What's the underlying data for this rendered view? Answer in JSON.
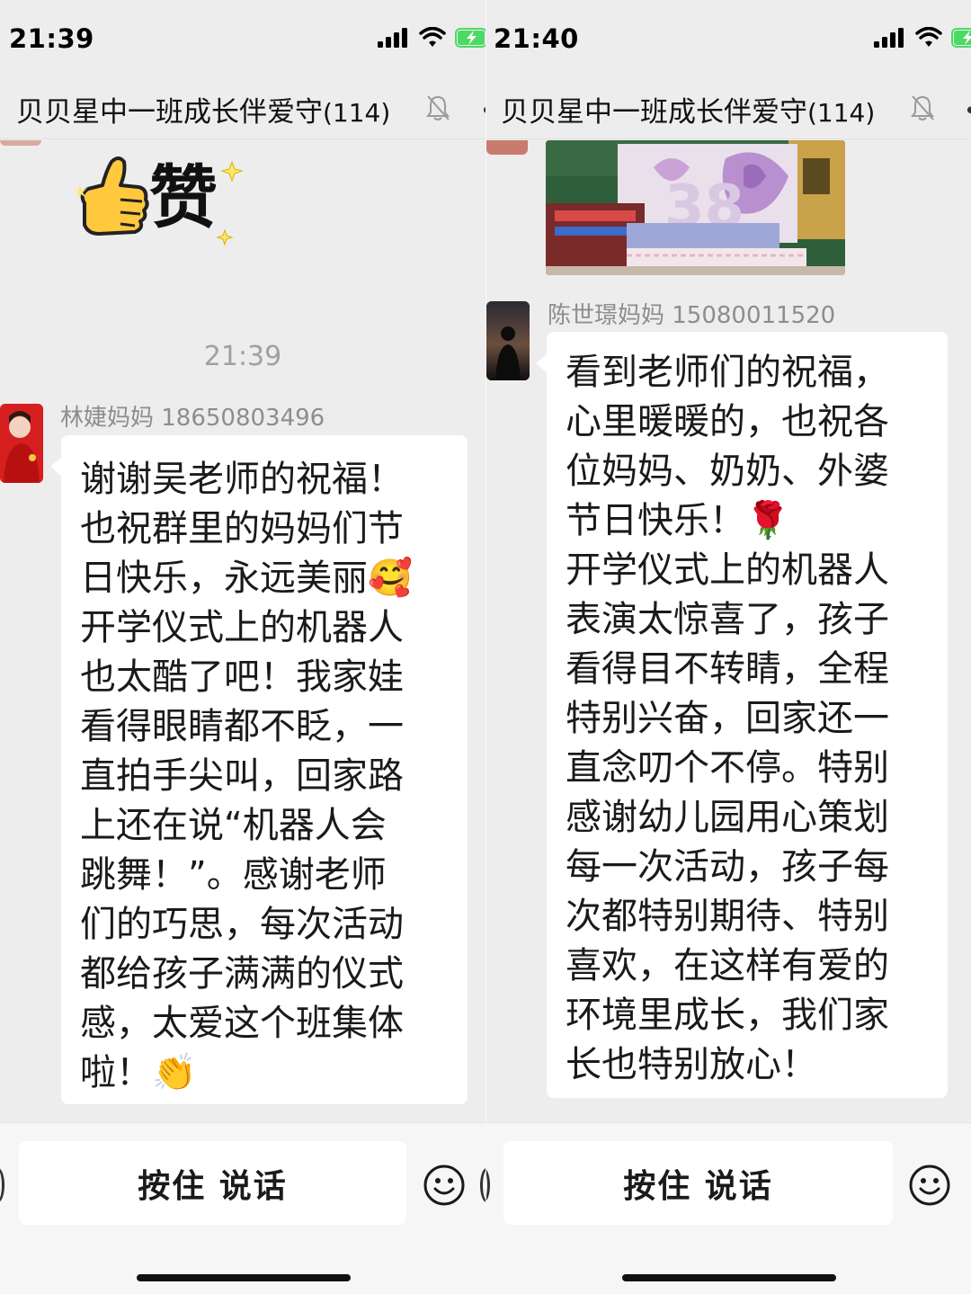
{
  "left": {
    "status_time": "21:39",
    "title": "贝贝星中一班成长伴爱守",
    "member_count": "(114)",
    "timestamp": "21:39",
    "sticker_text": "赞",
    "sender": "林婕妈妈 18650803496",
    "message": "谢谢吴老师的祝福！\n也祝群里的妈妈们节\n日快乐，永远美丽🥰\n开学仪式上的机器人\n也太酷了吧！我家娃\n看得眼睛都不眨，一\n直拍手尖叫，回家路\n上还在说“机器人会\n跳舞！”。感谢老师\n们的巧思，每次活动\n都给孩子满满的仪式\n感，太爱这个班集体\n啦！👏",
    "hold_to_talk": "按住 说话"
  },
  "right": {
    "status_time": "21:40",
    "title": "贝贝星中一班成长伴爱守",
    "member_count": "(114)",
    "sender": "陈世璟妈妈 15080011520",
    "message": "看到老师们的祝福，\n心里暖暖的，也祝各\n位妈妈、奶奶、外婆\n节日快乐！🌹\n开学仪式上的机器人\n表演太惊喜了，孩子\n看得目不转睛，全程\n特别兴奋，回家还一\n直念叨个不停。特别\n感谢幼儿园用心策划\n每一次活动，孩子每\n次都特别期待、特别\n喜欢，在这样有爱的\n环境里成长，我们家\n长也特别放心！",
    "hold_to_talk": "按住 说话"
  },
  "icons": [
    "signal-icon",
    "wifi-icon",
    "battery-charging-icon",
    "mute-bell-icon",
    "emoji-icon",
    "thumbs-up-sticker"
  ],
  "colors": {
    "background": "#ededed",
    "bubble": "#ffffff",
    "battery": "#4cd964",
    "meta_text": "#8d8d8d"
  }
}
